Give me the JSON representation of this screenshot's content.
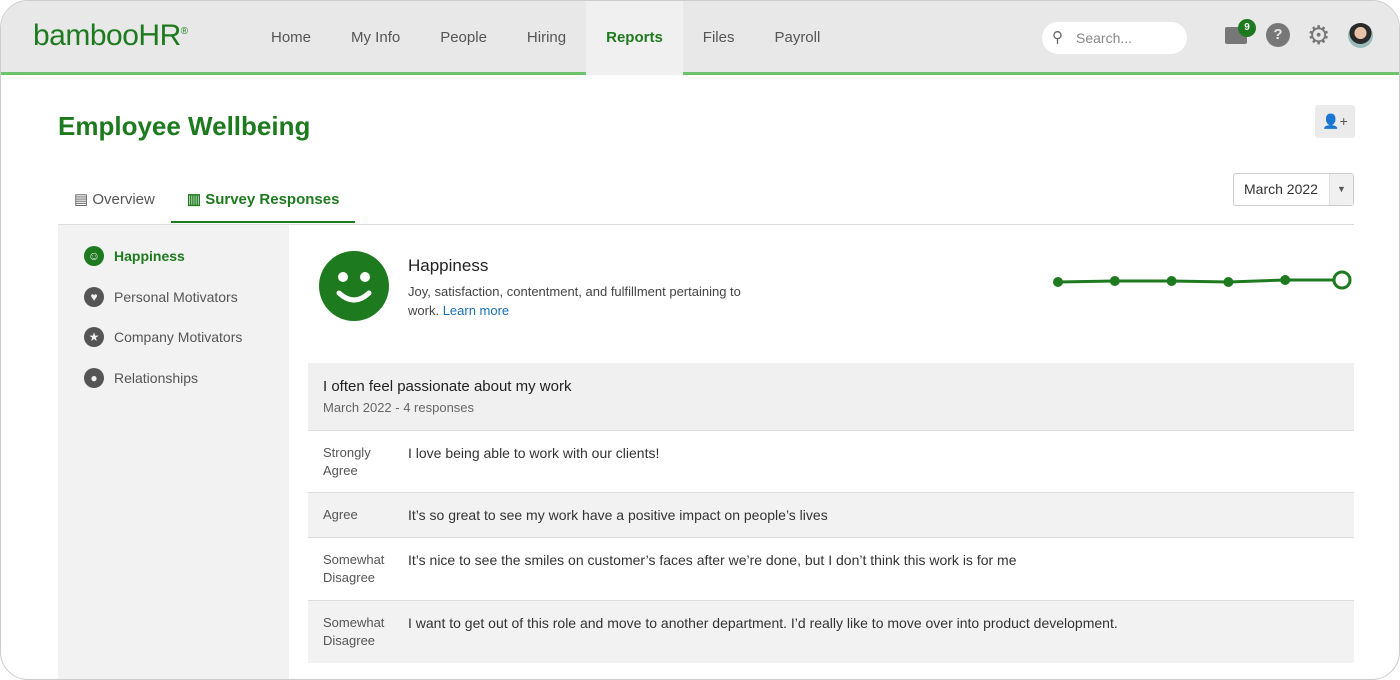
{
  "header": {
    "logo": "bambooHR",
    "nav": [
      "Home",
      "My Info",
      "People",
      "Hiring",
      "Reports",
      "Files",
      "Payroll"
    ],
    "active_nav": "Reports",
    "search_placeholder": "Search...",
    "notification_count": "9",
    "help_glyph": "?"
  },
  "page": {
    "title": "Employee Wellbeing"
  },
  "tabs": [
    {
      "label": "Overview"
    },
    {
      "label": "Survey Responses",
      "active": true
    }
  ],
  "period_select": {
    "value": "March 2022"
  },
  "sidebar": {
    "items": [
      {
        "label": "Happiness",
        "icon": "smile-icon",
        "active": true
      },
      {
        "label": "Personal Motivators",
        "icon": "personal-motivator-icon"
      },
      {
        "label": "Company Motivators",
        "icon": "company-motivator-icon"
      },
      {
        "label": "Relationships",
        "icon": "relationships-icon"
      }
    ]
  },
  "category": {
    "title": "Happiness",
    "description": "Joy, satisfaction, contentment, and fulfillment pertaining to work.",
    "link": "Learn more",
    "trend": [
      2,
      2.1,
      2.1,
      2,
      2.2,
      2.2
    ]
  },
  "question": {
    "title": "I often feel passionate about my work",
    "subtitle": "March 2022 - 4 responses",
    "responses": [
      {
        "rating": "Strongly Agree",
        "text": "I love being able to work with our clients!"
      },
      {
        "rating": "Agree",
        "text": "It’s so great to see my work have a positive impact on people’s lives"
      },
      {
        "rating": "Somewhat Disagree",
        "text": "It’s nice to see the smiles on customer’s faces after we’re done, but I don’t think this work is for me"
      },
      {
        "rating": "Somewhat Disagree",
        "text": "I want to get out of this role and move to another department. I’d really like to move over into product development."
      }
    ]
  },
  "colors": {
    "brand": "#1e7a1e",
    "header_line": "#6cc36c"
  }
}
